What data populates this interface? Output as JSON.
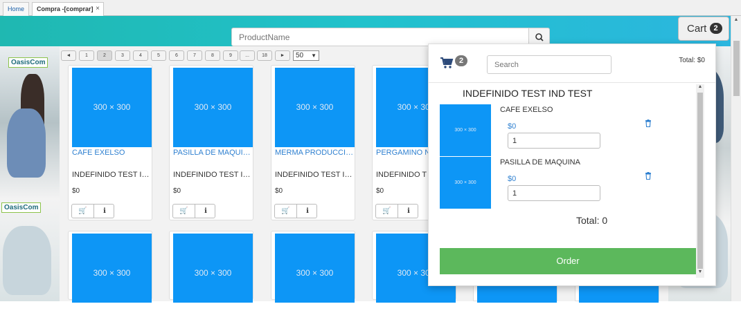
{
  "tabs": [
    {
      "label": "Home"
    },
    {
      "label": "Compra -[comprar]",
      "close": "×"
    }
  ],
  "header": {
    "search_placeholder": "ProductName",
    "cart_label": "Cart",
    "cart_count": "2"
  },
  "banner": {
    "logo_text": "OasisCom"
  },
  "pager": {
    "prev": "◄",
    "pages": [
      "1",
      "2",
      "3",
      "4",
      "5",
      "6",
      "7",
      "8",
      "9",
      "...",
      "18"
    ],
    "next": "►",
    "active_page": "2",
    "page_size": "50"
  },
  "products": [
    {
      "image": "300 × 300",
      "name": "CAFE EXELSO",
      "brand": "INDEFINIDO TEST IND TEST",
      "price": "$0"
    },
    {
      "image": "300 × 300",
      "name": "PASILLA DE MAQUINA",
      "brand": "INDEFINIDO TEST IND TEST",
      "price": "$0"
    },
    {
      "image": "300 × 300",
      "name": "MERMA PRODUCCION",
      "brand": "INDEFINIDO TEST IND TEST",
      "price": "$0"
    },
    {
      "image": "300 × 300",
      "name": "PERGAMINO N",
      "brand": "INDEFINIDO T",
      "price": "$0"
    }
  ],
  "products_row2": [
    {
      "image": "300 × 300"
    },
    {
      "image": "300 × 300"
    },
    {
      "image": "300 × 300"
    },
    {
      "image": "300 × 300"
    }
  ],
  "cart_panel": {
    "count": "2",
    "search_placeholder": "Search",
    "total_top": "Total: $0",
    "brand": "INDEFINIDO TEST IND TEST",
    "items": [
      {
        "image": "300 × 300",
        "name": "CAFE EXELSO",
        "price": "$0",
        "qty": "1"
      },
      {
        "image": "300 × 300",
        "name": "PASILLA DE MAQUINA",
        "price": "$0",
        "qty": "1"
      }
    ],
    "total": "Total: 0",
    "order_label": "Order"
  }
}
